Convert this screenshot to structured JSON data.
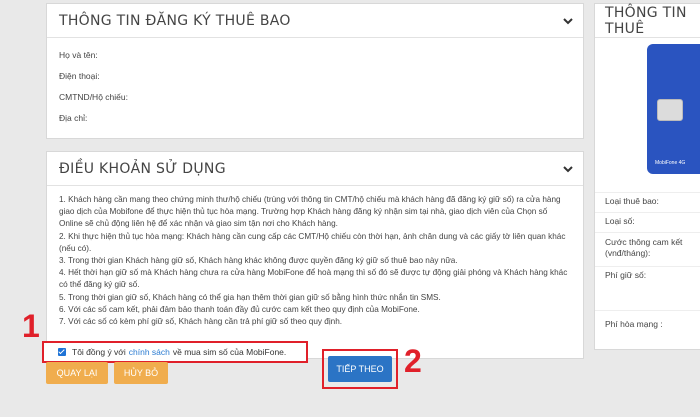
{
  "subscriber": {
    "title": "THÔNG TIN ĐĂNG KÝ THUÊ BAO",
    "fields": [
      "Họ và tên:",
      "Điện thoại:",
      "CMTND/Hộ chiếu:",
      "Địa chỉ:"
    ]
  },
  "terms": {
    "title": "ĐIỀU KHOẢN SỬ DỤNG",
    "items": [
      "1. Khách hàng cần mang theo chứng minh thư/hộ chiếu (trùng với thông tin CMT/hộ chiếu mà khách hàng đã đăng ký giữ số) ra cửa hàng giao dịch của Mobifone để thực hiện thủ tục hòa mạng. Trường hợp Khách hàng đăng ký nhận sim tại nhà, giao dịch viên của Chọn số Online sẽ chủ động liên hệ để xác nhận và giao sim tận nơi cho Khách hàng.",
      "2. Khi thực hiện thủ tục hòa mạng: Khách hàng cần cung cấp các CMT/Hộ chiếu còn thời hạn, ảnh chân dung và các giấy tờ liên quan khác (nếu có).",
      "3. Trong thời gian Khách hàng giữ số, Khách hàng khác không được quyền đăng ký giữ số thuê bao này nữa.",
      "4. Hết thời hạn giữ số mà Khách hàng chưa ra cửa hàng MobiFone để hoà mạng thì số đó sẽ được tự động giải phóng và Khách hàng khác có thể đăng ký giữ số.",
      "5. Trong thời gian giữ số, Khách hàng có thể gia hạn thêm thời gian giữ số bằng hình thức nhắn tin SMS.",
      "6. Với các số cam kết, phải đảm bảo thanh toán đầy đủ cước cam kết theo quy định của MobiFone.",
      "7. Với các số có kèm phí giữ số, Khách hàng cần trả phí giữ số theo quy định."
    ]
  },
  "agree": {
    "prefix": "Tôi đồng ý với",
    "link": "chính sách",
    "suffix": "về mua sim số của MobiFone."
  },
  "buttons": {
    "back": "QUAY LẠI",
    "cancel": "HỦY BỎ",
    "next": "TIẾP THEO"
  },
  "markers": {
    "one": "1",
    "two": "2"
  },
  "info": {
    "title": "THÔNG TIN THUÊ",
    "sim_label": "MobiFone 4G",
    "rows": [
      "Loại thuê bao:",
      "Loại số:",
      "Cước thông cam kết (vnđ/tháng):",
      "Phí giữ số:",
      "Phí hòa mạng :"
    ]
  },
  "colors": {
    "accent_red": "#e0202a",
    "orange": "#f0ad4e",
    "blue": "#2b74c5",
    "sim_blue": "#2a54c0"
  },
  "icons": [
    "chevron-down-icon",
    "checkbox-icon"
  ]
}
